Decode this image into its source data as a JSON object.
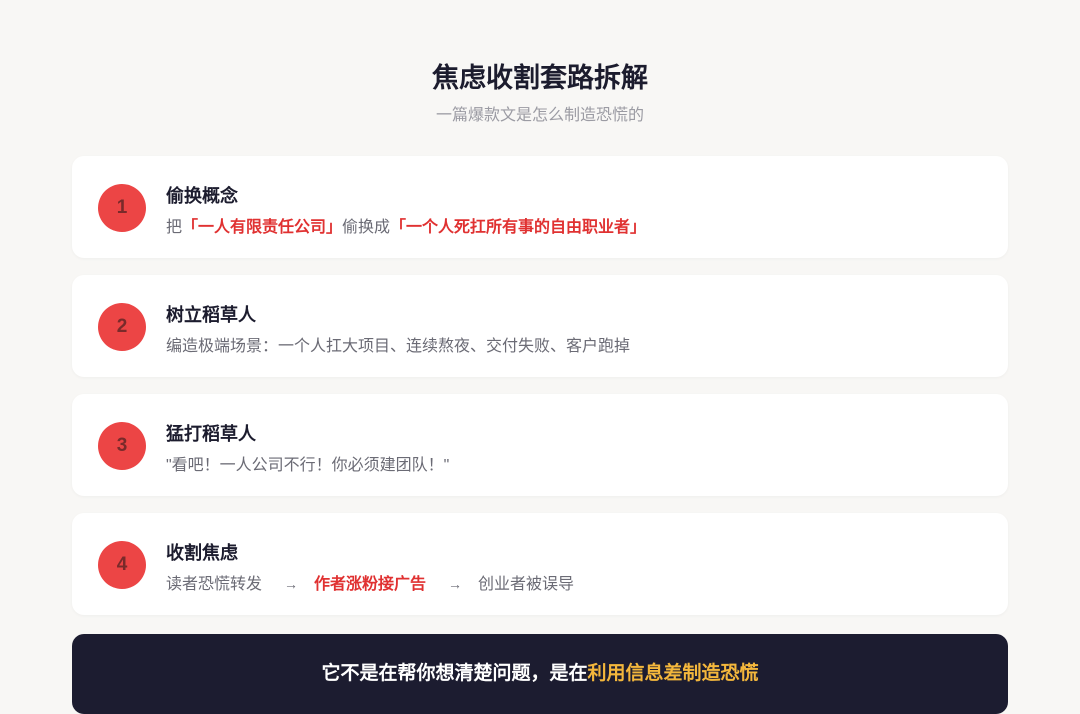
{
  "title": "焦虑收割套路拆解",
  "subtitle": "一篇爆款文是怎么制造恐慌的",
  "steps": [
    {
      "num": "1",
      "heading": "偷换概念",
      "desc_prefix": "把",
      "highlight_a": "「一人有限责任公司」",
      "desc_mid": "偷换成",
      "highlight_b": "「一个人死扛所有事的自由职业者」"
    },
    {
      "num": "2",
      "heading": "树立稻草人",
      "desc": "编造极端场景：一个人扛大项目、连续熬夜、交付失败、客户跑掉"
    },
    {
      "num": "3",
      "heading": "猛打稻草人",
      "desc": "\"看吧！一人公司不行！你必须建团队！\""
    },
    {
      "num": "4",
      "heading": "收割焦虑",
      "flow_a": "读者恐慌转发",
      "arrow_1": "→",
      "flow_b": "作者涨粉接广告",
      "arrow_2": "→",
      "flow_c": "创业者被误导"
    }
  ],
  "conclusion": {
    "prefix": "它不是在帮你想清楚问题，是在",
    "highlight": "利用信息差制造恐慌"
  },
  "colors": {
    "accent_red": "#ec4545",
    "highlight_red": "#e03131",
    "gold": "#f4b73c",
    "dark_panel": "#1c1c30"
  }
}
